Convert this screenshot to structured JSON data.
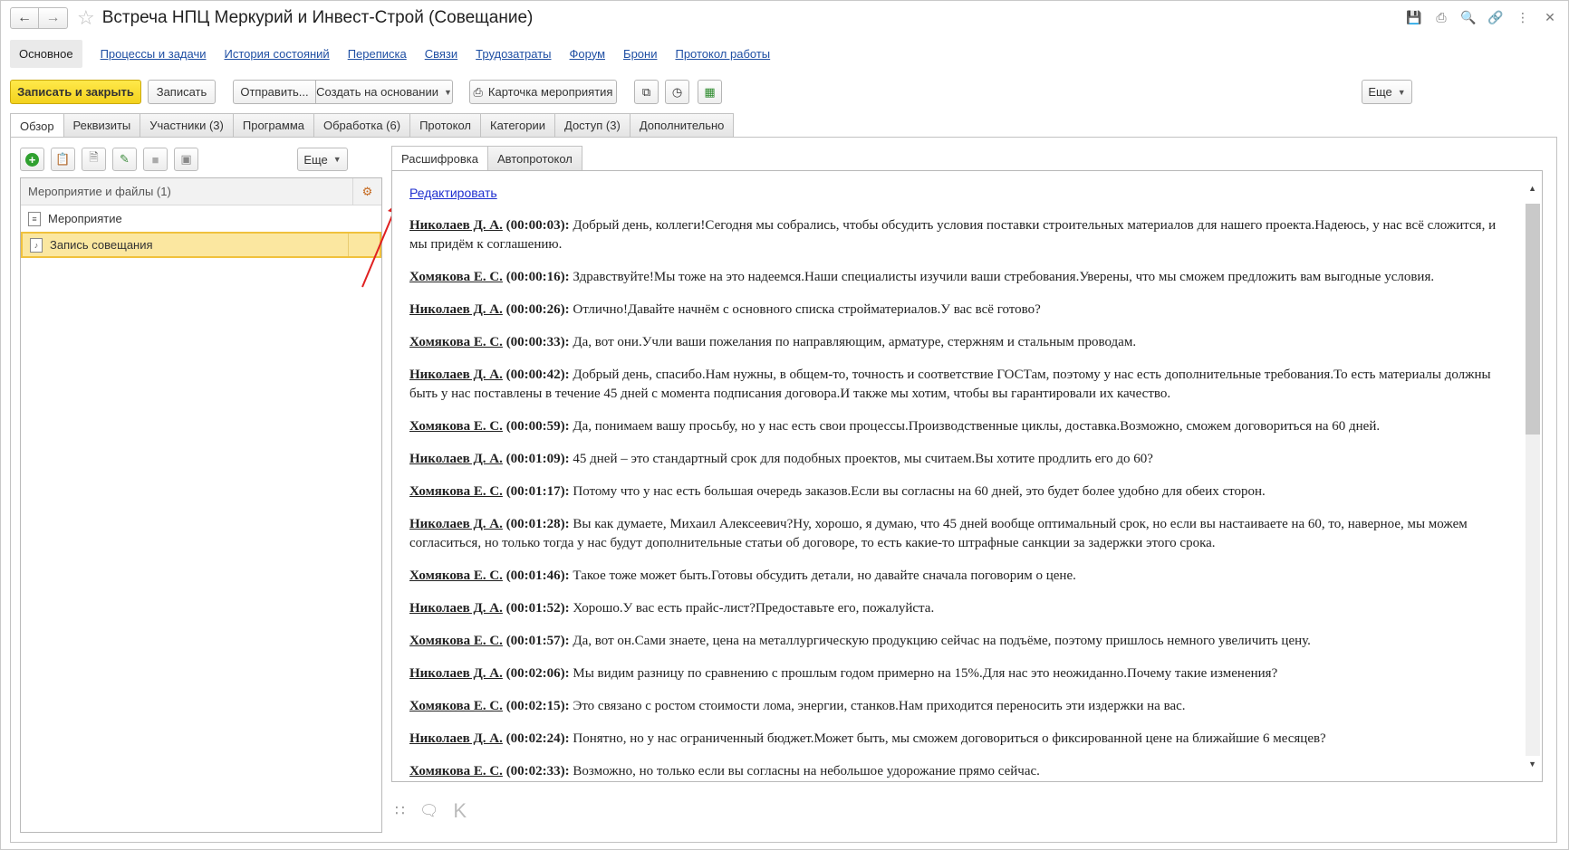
{
  "window": {
    "title": "Встреча НПЦ Меркурий и Инвест-Строй  (Совещание)",
    "nav_back_icon": "arrow-left-icon",
    "nav_forward_icon": "arrow-right-icon",
    "tool_icons": [
      "save-icon",
      "print-icon",
      "preview-icon",
      "link-icon",
      "more-icon",
      "close-icon"
    ]
  },
  "sections": {
    "active": "Основное",
    "links": [
      "Процессы и задачи",
      "История состояний",
      "Переписка",
      "Связи",
      "Трудозатраты",
      "Форум",
      "Брони",
      "Протокол работы"
    ]
  },
  "toolbar": {
    "save_close": "Записать и закрыть",
    "save": "Записать",
    "send": "Отправить...",
    "create_based": "Создать на основании",
    "event_card": "Карточка мероприятия",
    "more": "Еще",
    "accent_color": "#f5d91f"
  },
  "tabs": [
    "Обзор",
    "Реквизиты",
    "Участники (3)",
    "Программа",
    "Обработка (6)",
    "Протокол",
    "Категории",
    "Доступ (3)",
    "Дополнительно"
  ],
  "left_panel": {
    "more": "Еще",
    "header": "Мероприятие и файлы (1)",
    "items": [
      "Мероприятие",
      "Запись совещания"
    ]
  },
  "subtabs": [
    "Расшифровка",
    "Автопротокол"
  ],
  "transcript": {
    "edit_link": "Редактировать",
    "entries": [
      {
        "speaker": "Николаев Д. А.",
        "time": "(00:00:03):",
        "text": "Добрый день, коллеги!Сегодня мы собрались, чтобы обсудить условия поставки строительных материалов для нашего проекта.Надеюсь, у нас всё сложится, и мы придём к соглашению."
      },
      {
        "speaker": "Хомякова Е. С.",
        "time": "(00:00:16):",
        "text": "Здравствуйте!Мы тоже на это надеемся.Наши специалисты изучили ваши стребования.Уверены, что мы сможем предложить вам выгодные условия."
      },
      {
        "speaker": "Николаев Д. А.",
        "time": "(00:00:26):",
        "text": "Отлично!Давайте начнём с основного списка стройматериалов.У вас всё готово?"
      },
      {
        "speaker": "Хомякова Е. С.",
        "time": "(00:00:33):",
        "text": "Да, вот они.Учли ваши пожелания по направляющим, арматуре, стержням и стальным проводам."
      },
      {
        "speaker": "Николаев Д. А.",
        "time": "(00:00:42):",
        "text": "Добрый день, спасибо.Нам нужны, в общем-то, точность и соответствие ГОСТам, поэтому у нас есть дополнительные требования.То есть материалы должны быть у нас поставлены в течение 45 дней с момента подписания договора.И также мы хотим, чтобы вы гарантировали их качество."
      },
      {
        "speaker": "Хомякова Е. С.",
        "time": "(00:00:59):",
        "text": "Да, понимаем вашу просьбу, но у нас есть свои процессы.Производственные циклы, доставка.Возможно, сможем договориться на 60 дней."
      },
      {
        "speaker": "Николаев Д. А.",
        "time": "(00:01:09):",
        "text": "45 дней – это стандартный срок для подобных проектов, мы считаем.Вы хотите продлить его до 60?"
      },
      {
        "speaker": "Хомякова Е. С.",
        "time": "(00:01:17):",
        "text": "Потому что у нас есть большая очередь заказов.Если вы согласны на 60 дней, это будет более удобно для обеих сторон."
      },
      {
        "speaker": "Николаев Д. А.",
        "time": "(00:01:28):",
        "text": "Вы как думаете, Михаил Алексеевич?Ну, хорошо, я думаю, что 45 дней вообще оптимальный срок, но если вы настаиваете на 60, то, наверное, мы можем согласиться, но только тогда у нас будут дополнительные статьи об договоре, то есть какие-то штрафные санкции за задержки этого срока."
      },
      {
        "speaker": "Хомякова Е. С.",
        "time": "(00:01:46):",
        "text": "Такое тоже может быть.Готовы обсудить детали, но давайте сначала поговорим о цене."
      },
      {
        "speaker": "Николаев Д. А.",
        "time": "(00:01:52):",
        "text": "Хорошо.У вас есть прайс-лист?Предоставьте его, пожалуйста."
      },
      {
        "speaker": "Хомякова Е. С.",
        "time": "(00:01:57):",
        "text": "Да, вот он.Сами знаете, цена на металлургическую продукцию сейчас на подъёме, поэтому пришлось немного увеличить цену."
      },
      {
        "speaker": "Николаев Д. А.",
        "time": "(00:02:06):",
        "text": "Мы видим разницу по сравнению с прошлым годом примерно на 15%.Для нас это неожиданно.Почему такие изменения?"
      },
      {
        "speaker": "Хомякова Е. С.",
        "time": "(00:02:15):",
        "text": "Это связано с ростом стоимости лома, энергии, станков.Нам приходится переносить эти издержки на вас."
      },
      {
        "speaker": "Николаев Д. А.",
        "time": "(00:02:24):",
        "text": "Понятно, но у нас ограниченный бюджет.Может быть, мы сможем договориться о фиксированной цене на ближайшие 6 месяцев?"
      },
      {
        "speaker": "Хомякова Е. С.",
        "time": "(00:02:33):",
        "text": "Возможно, но только если вы согласны на небольшое удорожание прямо сейчас."
      }
    ]
  },
  "bottom": {
    "k_label": "K"
  }
}
